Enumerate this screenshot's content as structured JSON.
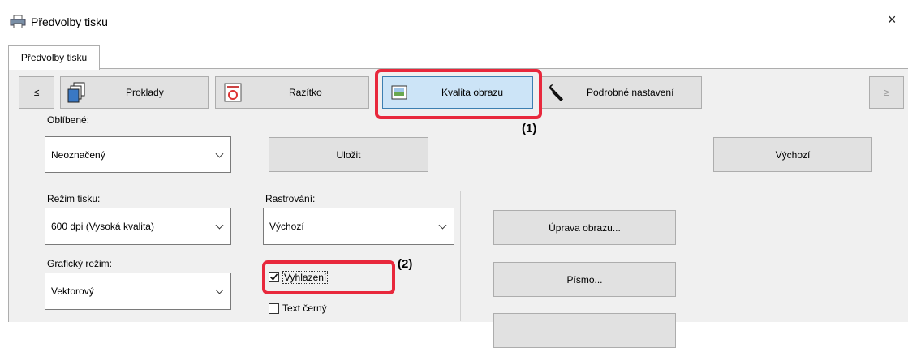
{
  "window": {
    "title": "Předvolby tisku",
    "close": "×"
  },
  "tab": {
    "label": "Předvolby tisku"
  },
  "nav": {
    "prev": "≤",
    "next": "≥",
    "items": [
      {
        "label": "Proklady",
        "icon": "pages-stack-icon"
      },
      {
        "label": "Razítko",
        "icon": "stamp-icon"
      },
      {
        "label": "Kvalita obrazu",
        "icon": "image-quality-icon"
      },
      {
        "label": "Podrobné nastavení",
        "icon": "wrench-icon"
      }
    ]
  },
  "favorites": {
    "label": "Oblíbené:",
    "value": "Neoznačený",
    "save": "Uložit",
    "default": "Výchozí"
  },
  "print_mode": {
    "label": "Režim tisku:",
    "value": "600 dpi (Vysoká kvalita)"
  },
  "rasterization": {
    "label": "Rastrování:",
    "value": "Výchozí"
  },
  "graphics_mode": {
    "label": "Grafický režim:",
    "value": "Vektorový"
  },
  "smoothing": {
    "label": "Vyhlazení",
    "checked": true
  },
  "black_text": {
    "label": "Text černý",
    "checked": false
  },
  "buttons": {
    "image_adjust": "Úprava obrazu...",
    "font": "Písmo..."
  },
  "callouts": {
    "one": "(1)",
    "two": "(2)"
  },
  "colors": {
    "highlight": "#e8283c",
    "selected_tab": "#cce4f7"
  }
}
